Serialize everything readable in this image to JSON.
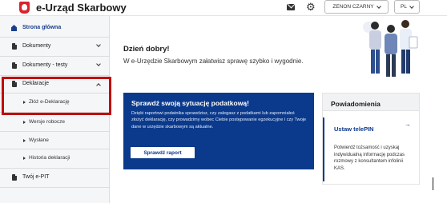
{
  "header": {
    "app_title": "e-Urząd Skarbowy",
    "user_label": "ZENON CZARNY",
    "lang_label": "PL",
    "icons": [
      "mail-icon",
      "gear-icon",
      "chevron-down-icon"
    ]
  },
  "sidebar": {
    "items": [
      {
        "label": "Strona główna",
        "icon": "home-icon",
        "active": true
      },
      {
        "label": "Dokumenty",
        "icon": "document-icon"
      },
      {
        "label": "Dokumenty - testy",
        "icon": "document-icon"
      },
      {
        "label": "Deklaracje",
        "icon": "document-icon",
        "expanded": true
      },
      {
        "label": "Twój e-PIT",
        "icon": "document-icon"
      }
    ],
    "sub_items": [
      {
        "label": "Złóż e-Deklarację"
      },
      {
        "label": "Wersje robocze"
      },
      {
        "label": "Wysłane"
      },
      {
        "label": "Historia deklaracji"
      }
    ]
  },
  "main": {
    "greeting": "Dzień dobry!",
    "welcome": "W e-Urzędzie Skarbowym załatwisz sprawę szybko i wygodnie.",
    "promo": {
      "title": "Sprawdź swoją sytuację podatkową!",
      "text": "Dzięki raportowi podatnika sprawdzisz, czy zalegasz z podatkami lub zapomniałeś złożyć deklarację, czy prowadzimy wobec Ciebie postępowanie egzekucyjne i czy Twoje dane w urzędzie skarbowym są aktualne.",
      "button": "Sprawdź raport"
    },
    "notifications": {
      "title": "Powiadomienia",
      "item_title": "Ustaw telePIN",
      "item_text": "Potwierdź tożsamość i uzyskaj indywidualną informację podczas rozmowy z konsultantem infolinii KAS."
    }
  },
  "colors": {
    "brand_blue": "#0b3a8c",
    "highlight_red": "#c00d0d",
    "logo_red": "#d9232d"
  }
}
